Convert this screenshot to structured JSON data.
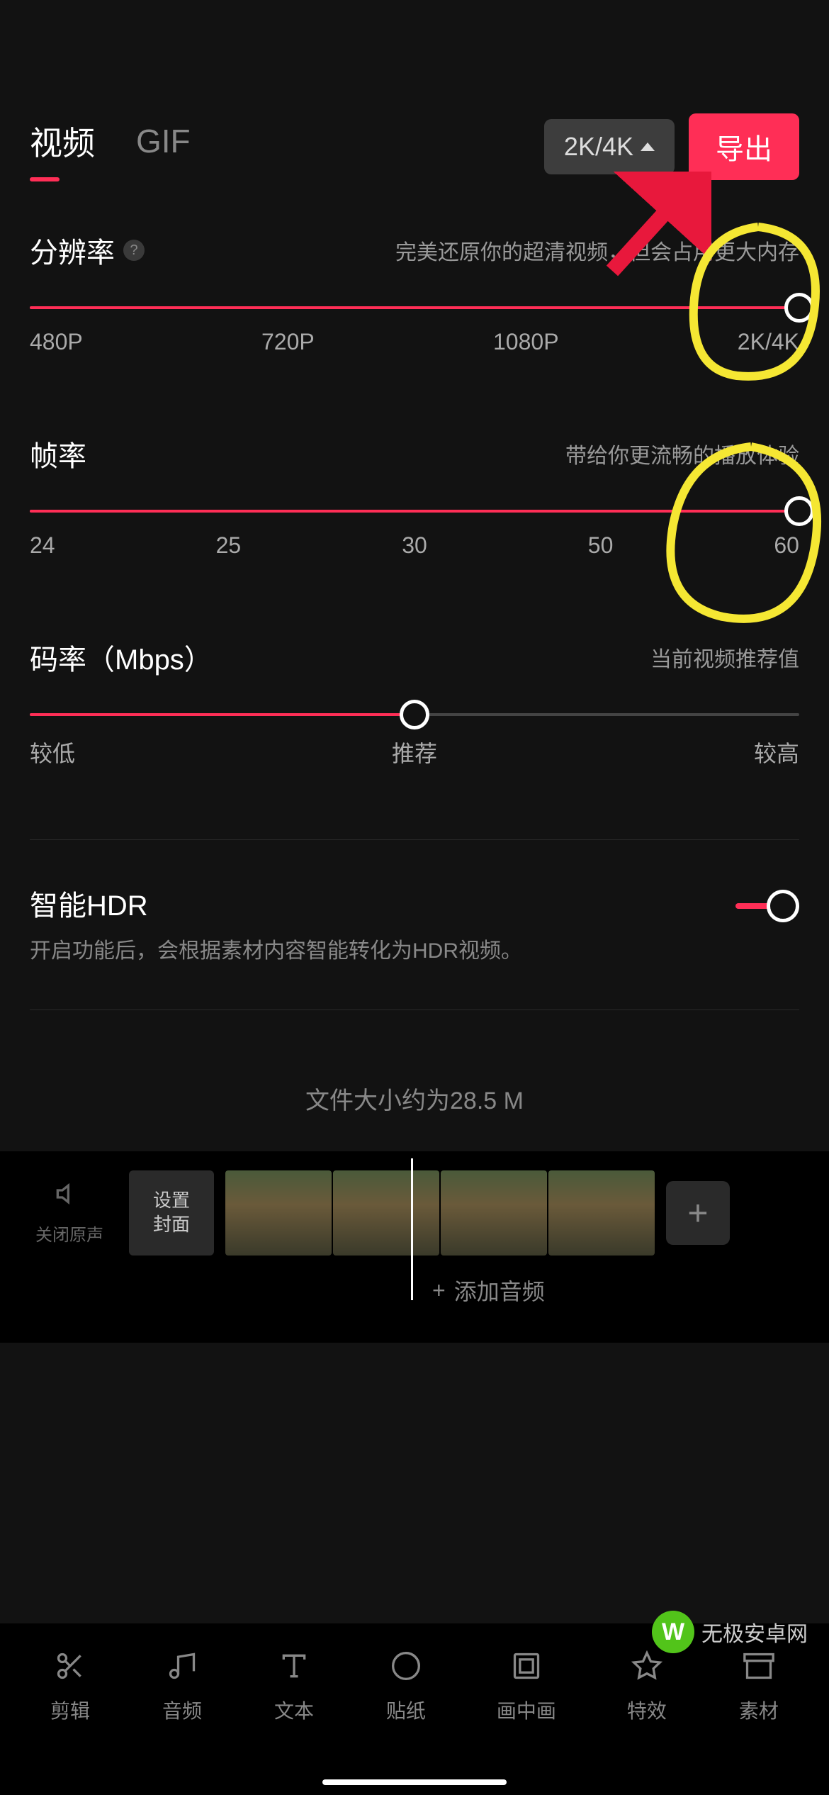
{
  "header": {
    "tabs": {
      "video": "视频",
      "gif": "GIF"
    },
    "resolution_badge": "2K/4K",
    "export_label": "导出"
  },
  "resolution": {
    "title": "分辨率",
    "hint": "完美还原你的超清视频，但会占用更大内存",
    "ticks": [
      "480P",
      "720P",
      "1080P",
      "2K/4K"
    ],
    "value_index": 3
  },
  "framerate": {
    "title": "帧率",
    "hint": "带给你更流畅的播放体验",
    "ticks": [
      "24",
      "25",
      "30",
      "50",
      "60"
    ],
    "value_index": 4
  },
  "bitrate": {
    "title": "码率（Mbps）",
    "hint": "当前视频推荐值",
    "labels": {
      "low": "较低",
      "rec": "推荐",
      "high": "较高"
    },
    "value_pct": 50
  },
  "hdr": {
    "title": "智能HDR",
    "desc": "开启功能后，会根据素材内容智能转化为HDR视频。",
    "enabled": true
  },
  "filesize_label": "文件大小约为28.5 M",
  "timeline": {
    "mute_label": "关闭原声",
    "cover_line1": "设置",
    "cover_line2": "封面",
    "add_audio": "添加音频"
  },
  "nav": {
    "cut": "剪辑",
    "audio": "音频",
    "text": "文本",
    "sticker": "贴纸",
    "pip": "画中画",
    "effects": "特效",
    "material": "素材"
  },
  "watermark": "无极安卓网"
}
